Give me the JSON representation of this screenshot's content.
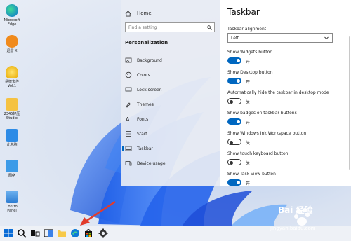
{
  "desktop": {
    "icons": [
      {
        "label": "Microsoft Edge",
        "icon": "edge-icon"
      },
      {
        "label": "迅雷 X",
        "icon": "thunder-icon"
      },
      {
        "label": "易捷文件 Vol.1",
        "icon": "bulb-icon"
      },
      {
        "label": "2345好压 Studio",
        "icon": "folder-icon"
      },
      {
        "label": "此电脑",
        "icon": "computer-icon"
      },
      {
        "label": "网络",
        "icon": "network-icon"
      },
      {
        "label": "Control Panel",
        "icon": "control-panel-icon"
      }
    ]
  },
  "settings": {
    "nav": {
      "home": "Home",
      "search_placeholder": "Find a setting",
      "section": "Personalization",
      "items": [
        {
          "label": "Background",
          "icon": "picture-icon"
        },
        {
          "label": "Colors",
          "icon": "palette-icon"
        },
        {
          "label": "Lock screen",
          "icon": "monitor-icon"
        },
        {
          "label": "Themes",
          "icon": "brush-icon"
        },
        {
          "label": "Fonts",
          "icon": "font-icon"
        },
        {
          "label": "Start",
          "icon": "start-icon"
        },
        {
          "label": "Taskbar",
          "icon": "taskbar-icon"
        },
        {
          "label": "Device usage",
          "icon": "device-icon"
        }
      ],
      "active": "Taskbar"
    },
    "content": {
      "title": "Taskbar",
      "alignment_label": "Taskbar alignment",
      "alignment_value": "Left",
      "toggles": [
        {
          "label": "Show Widgets button",
          "state": "开",
          "on": true
        },
        {
          "label": "Show Desktop button",
          "state": "开",
          "on": true
        },
        {
          "label": "Automatically hide the taskbar in desktop mode",
          "state": "关",
          "on": false
        },
        {
          "label": "Show badges on taskbar buttons",
          "state": "开",
          "on": true
        },
        {
          "label": "Show Windows Ink Workspace button",
          "state": "关",
          "on": false
        },
        {
          "label": "Show touch keyboard button",
          "state": "关",
          "on": false
        },
        {
          "label": "Show Task View button",
          "state": "开",
          "on": true
        }
      ]
    }
  },
  "taskbar": {
    "items": [
      "start-icon",
      "search-icon",
      "task-view-icon",
      "widgets-icon",
      "file-explorer-icon",
      "edge-icon",
      "store-icon",
      "settings-icon"
    ]
  },
  "watermark": {
    "text": "Bai 经验",
    "url": "jingyan.baidu.com"
  },
  "colors": {
    "accent": "#0067c0"
  }
}
